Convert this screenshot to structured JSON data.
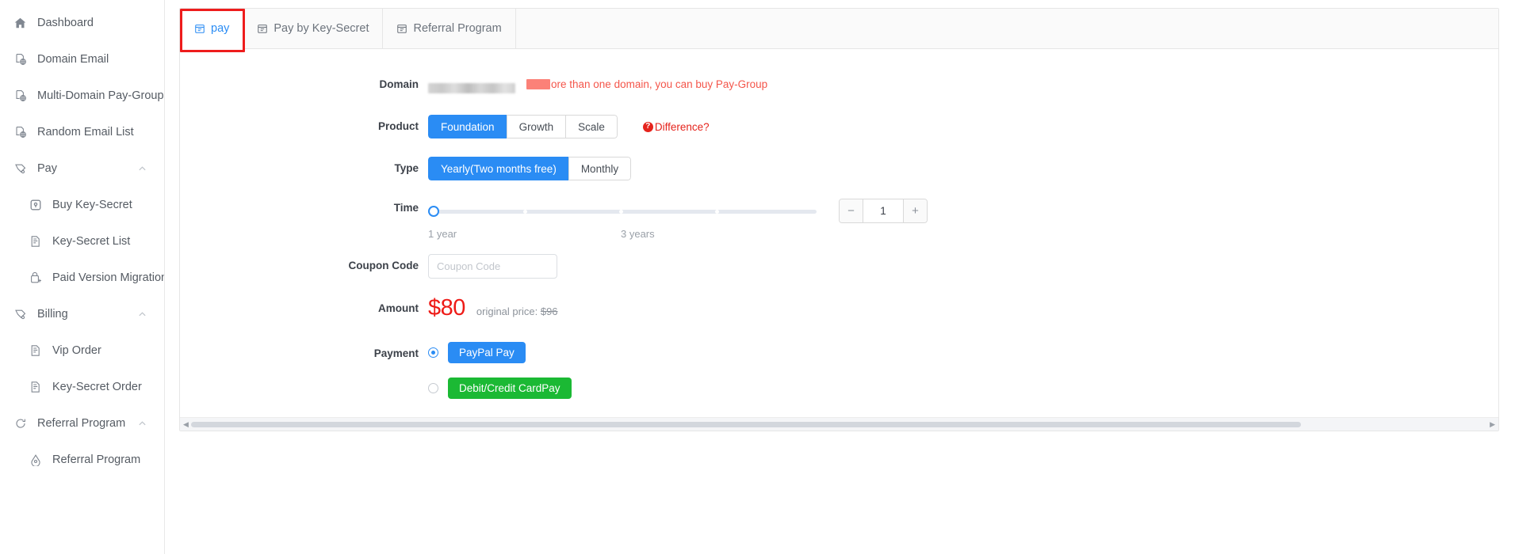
{
  "sidebar": {
    "items": [
      {
        "label": "Dashboard",
        "icon": "home-icon",
        "level": 0,
        "collapsible": false
      },
      {
        "label": "Domain Email",
        "icon": "globe-doc-icon",
        "level": 0,
        "collapsible": false
      },
      {
        "label": "Multi-Domain Pay-Group",
        "icon": "globe-doc-icon",
        "level": 0,
        "collapsible": false
      },
      {
        "label": "Random Email List",
        "icon": "globe-doc-icon",
        "level": 0,
        "collapsible": false
      },
      {
        "label": "Pay",
        "icon": "tag-icon",
        "level": 0,
        "collapsible": true,
        "chevron": "chevron-up-icon"
      },
      {
        "label": "Buy Key-Secret",
        "icon": "key-box-icon",
        "level": 1,
        "collapsible": false
      },
      {
        "label": "Key-Secret List",
        "icon": "list-doc-icon",
        "level": 1,
        "collapsible": false
      },
      {
        "label": "Paid Version Migration",
        "icon": "migration-icon",
        "level": 1,
        "collapsible": false
      },
      {
        "label": "Billing",
        "icon": "tag-icon",
        "level": 0,
        "collapsible": true,
        "chevron": "chevron-up-icon"
      },
      {
        "label": "Vip Order",
        "icon": "list-doc-icon",
        "level": 1,
        "collapsible": false
      },
      {
        "label": "Key-Secret Order",
        "icon": "list-doc-icon",
        "level": 1,
        "collapsible": false
      },
      {
        "label": "Referral Program",
        "icon": "refresh-icon",
        "level": 0,
        "collapsible": true,
        "chevron": "chevron-up-icon"
      },
      {
        "label": "Referral Program",
        "icon": "gift-icon",
        "level": 1,
        "collapsible": false
      }
    ]
  },
  "tabs": [
    {
      "label": "pay",
      "icon": "calendar-icon",
      "active": true
    },
    {
      "label": "Pay by Key-Secret",
      "icon": "calendar-icon",
      "active": false
    },
    {
      "label": "Referral Program",
      "icon": "calendar-icon",
      "active": false
    }
  ],
  "form": {
    "domain": {
      "label": "Domain",
      "value_redacted": true,
      "hint": "ore than one domain, you can buy Pay-Group",
      "hint_color": "#f4554a"
    },
    "product": {
      "label": "Product",
      "options": [
        "Foundation",
        "Growth",
        "Scale"
      ],
      "selected": "Foundation",
      "difference_link": "Difference?",
      "difference_icon": "question-circle-icon"
    },
    "type": {
      "label": "Type",
      "options": [
        "Yearly(Two months free)",
        "Monthly"
      ],
      "selected": "Yearly(Two months free)"
    },
    "time": {
      "label": "Time",
      "min_label": "1 year",
      "max_label": "3 years",
      "value": 1,
      "quantity": "1",
      "minus_label": "−",
      "plus_label": "+"
    },
    "coupon": {
      "label": "Coupon Code",
      "placeholder": "Coupon Code",
      "value": ""
    },
    "amount": {
      "label": "Amount",
      "price": "$80",
      "original_prefix": "original price:",
      "original_price": "$96",
      "price_color": "#ee1b17"
    },
    "payment": {
      "label": "Payment",
      "methods": [
        {
          "label": "PayPal Pay",
          "selected": true,
          "color": "#2a8cf4"
        },
        {
          "label": "Debit/Credit CardPay",
          "selected": false,
          "color": "#1bb934"
        }
      ]
    }
  },
  "scrollbar": {
    "left_arrow": "◀",
    "right_arrow": "▶"
  },
  "theme": {
    "accent": "#2a8cf4",
    "danger": "#ee1b17",
    "success": "#1bb934",
    "annotation": "#ee1c1c"
  }
}
